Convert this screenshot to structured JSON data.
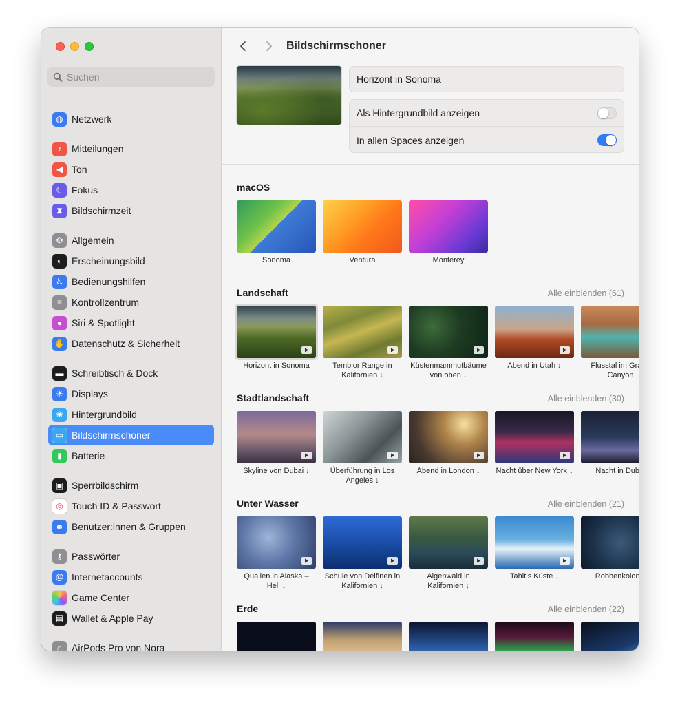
{
  "window_title": "Bildschirmschoner",
  "search": {
    "placeholder": "Suchen"
  },
  "sidebar": {
    "items": [
      {
        "label": "Netzwerk",
        "icon": "globe-icon",
        "color": "#3a7bf0"
      },
      {
        "label": "Mitteilungen",
        "icon": "bell-icon",
        "color": "#f05545"
      },
      {
        "label": "Ton",
        "icon": "speaker-icon",
        "color": "#f05545"
      },
      {
        "label": "Fokus",
        "icon": "moon-icon",
        "color": "#6a5ce8"
      },
      {
        "label": "Bildschirmzeit",
        "icon": "hourglass-icon",
        "color": "#6a5ce8"
      },
      {
        "label": "Allgemein",
        "icon": "gear-icon",
        "color": "#8e8e93"
      },
      {
        "label": "Erscheinungsbild",
        "icon": "appearance-icon",
        "color": "#1d1d1f"
      },
      {
        "label": "Bedienungshilfen",
        "icon": "accessibility-icon",
        "color": "#3a7bf0"
      },
      {
        "label": "Kontrollzentrum",
        "icon": "control-center-icon",
        "color": "#8e8e93"
      },
      {
        "label": "Siri & Spotlight",
        "icon": "siri-icon",
        "color": "#c64fd0"
      },
      {
        "label": "Datenschutz & Sicherheit",
        "icon": "hand-icon",
        "color": "#3a7bf0"
      },
      {
        "label": "Schreibtisch & Dock",
        "icon": "dock-icon",
        "color": "#1d1d1f"
      },
      {
        "label": "Displays",
        "icon": "sun-icon",
        "color": "#3a7bf0"
      },
      {
        "label": "Hintergrundbild",
        "icon": "flower-icon",
        "color": "#3aa8f0"
      },
      {
        "label": "Bildschirmschoner",
        "icon": "screensaver-icon",
        "color": "#3aa8f0"
      },
      {
        "label": "Batterie",
        "icon": "battery-icon",
        "color": "#34c759"
      },
      {
        "label": "Sperrbildschirm",
        "icon": "lock-icon",
        "color": "#1d1d1f"
      },
      {
        "label": "Touch ID & Passwort",
        "icon": "fingerprint-icon",
        "color": "#ffffff"
      },
      {
        "label": "Benutzer:innen & Gruppen",
        "icon": "users-icon",
        "color": "#3a7bf0"
      },
      {
        "label": "Passwörter",
        "icon": "key-icon",
        "color": "#8e8e93"
      },
      {
        "label": "Internetaccounts",
        "icon": "at-icon",
        "color": "#3a7bf0"
      },
      {
        "label": "Game Center",
        "icon": "game-center-icon",
        "color": "#ffffff"
      },
      {
        "label": "Wallet & Apple Pay",
        "icon": "wallet-icon",
        "color": "#1d1d1f"
      },
      {
        "label": "AirPods Pro von Nora",
        "icon": "airpods-icon",
        "color": "#8e8e93"
      }
    ],
    "active": "Bildschirmschoner"
  },
  "main": {
    "title": "Bildschirmschoner",
    "selected_saver": "Horizont in Sonoma",
    "toggles": [
      {
        "label": "Als Hintergrundbild anzeigen",
        "on": false
      },
      {
        "label": "In allen Spaces anzeigen",
        "on": true
      }
    ],
    "sections": [
      {
        "title": "macOS",
        "show_all": "",
        "tiles": [
          {
            "caption": "Sonoma",
            "video": false
          },
          {
            "caption": "Ventura",
            "video": false
          },
          {
            "caption": "Monterey",
            "video": false
          }
        ]
      },
      {
        "title": "Landschaft",
        "show_all": "Alle einblenden (61)",
        "tiles": [
          {
            "caption": "Horizont in Sonoma",
            "video": true,
            "selected": true
          },
          {
            "caption": "Temblor Range in Kalifornien ↓",
            "video": true
          },
          {
            "caption": "Küstenmammutbäume von oben ↓",
            "video": true
          },
          {
            "caption": "Abend in Utah ↓",
            "video": true
          },
          {
            "caption": "Flusstal im Grand Canyon",
            "video": true
          }
        ]
      },
      {
        "title": "Stadtlandschaft",
        "show_all": "Alle einblenden (30)",
        "tiles": [
          {
            "caption": "Skyline von Dubai ↓",
            "video": true
          },
          {
            "caption": "Überführung in Los Angeles ↓",
            "video": true
          },
          {
            "caption": "Abend in London ↓",
            "video": true
          },
          {
            "caption": "Nacht über New York ↓",
            "video": true
          },
          {
            "caption": "Nacht in Dubai",
            "video": true
          }
        ]
      },
      {
        "title": "Unter Wasser",
        "show_all": "Alle einblenden (21)",
        "tiles": [
          {
            "caption": "Quallen in Alaska – Hell ↓",
            "video": true
          },
          {
            "caption": "Schule von Delfinen in Kalifornien ↓",
            "video": true
          },
          {
            "caption": "Algenwald in Kalifornien ↓",
            "video": true
          },
          {
            "caption": "Tahitis Küste ↓",
            "video": true
          },
          {
            "caption": "Robbenkolonie",
            "video": false
          }
        ]
      },
      {
        "title": "Erde",
        "show_all": "Alle einblenden (22)",
        "tiles": [
          {
            "caption": "",
            "video": false
          },
          {
            "caption": "",
            "video": false
          },
          {
            "caption": "",
            "video": false
          },
          {
            "caption": "",
            "video": false
          },
          {
            "caption": "",
            "video": false
          }
        ]
      }
    ]
  }
}
